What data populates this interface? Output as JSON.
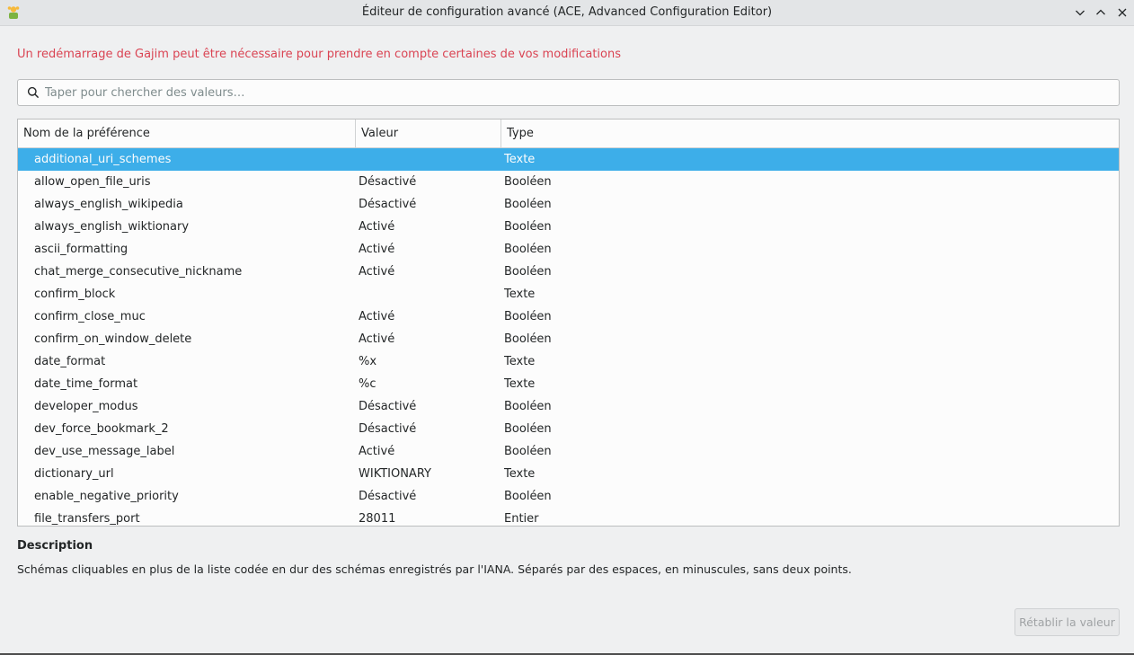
{
  "window": {
    "title": "Éditeur de configuration avancé (ACE, Advanced Configuration Editor)"
  },
  "warning": "Un redémarrage de Gajim peut être nécessaire pour prendre en compte certaines de vos modifications",
  "search": {
    "placeholder": "Taper pour chercher des valeurs…",
    "value": ""
  },
  "table": {
    "headers": {
      "name": "Nom de la préférence",
      "value": "Valeur",
      "type": "Type"
    },
    "rows": [
      {
        "name": "additional_uri_schemes",
        "value": "",
        "type": "Texte",
        "selected": true
      },
      {
        "name": "allow_open_file_uris",
        "value": "Désactivé",
        "type": "Booléen"
      },
      {
        "name": "always_english_wikipedia",
        "value": "Désactivé",
        "type": "Booléen"
      },
      {
        "name": "always_english_wiktionary",
        "value": "Activé",
        "type": "Booléen"
      },
      {
        "name": "ascii_formatting",
        "value": "Activé",
        "type": "Booléen"
      },
      {
        "name": "chat_merge_consecutive_nickname",
        "value": "Activé",
        "type": "Booléen"
      },
      {
        "name": "confirm_block",
        "value": "",
        "type": "Texte"
      },
      {
        "name": "confirm_close_muc",
        "value": "Activé",
        "type": "Booléen"
      },
      {
        "name": "confirm_on_window_delete",
        "value": "Activé",
        "type": "Booléen"
      },
      {
        "name": "date_format",
        "value": "%x",
        "type": "Texte"
      },
      {
        "name": "date_time_format",
        "value": "%c",
        "type": "Texte"
      },
      {
        "name": "developer_modus",
        "value": "Désactivé",
        "type": "Booléen"
      },
      {
        "name": "dev_force_bookmark_2",
        "value": "Désactivé",
        "type": "Booléen"
      },
      {
        "name": "dev_use_message_label",
        "value": "Activé",
        "type": "Booléen"
      },
      {
        "name": "dictionary_url",
        "value": "WIKTIONARY",
        "type": "Texte"
      },
      {
        "name": "enable_negative_priority",
        "value": "Désactivé",
        "type": "Booléen"
      },
      {
        "name": "file_transfers_port",
        "value": "28011",
        "type": "Entier"
      }
    ]
  },
  "description": {
    "title": "Description",
    "text": "Schémas cliquables en plus de la liste codée en dur des schémas enregistrés par l'IANA. Séparés par des espaces, en minuscules, sans deux points."
  },
  "reset_button": "Rétablir la valeur",
  "colors": {
    "selection": "#3daee9",
    "warning": "#da4453",
    "background": "#eff0f1"
  }
}
